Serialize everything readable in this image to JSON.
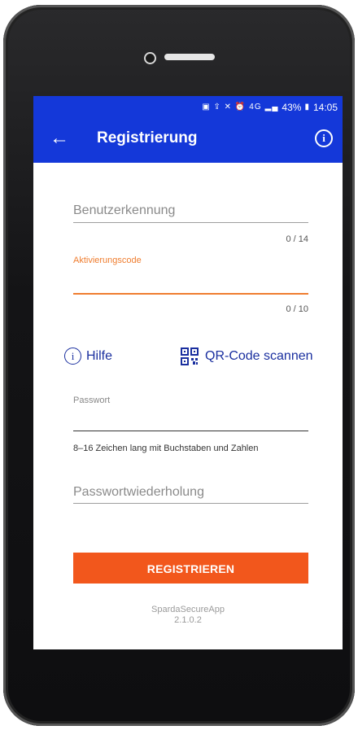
{
  "statusbar": {
    "battery_percent": "43%",
    "time": "14:05",
    "network": "4G",
    "icons": [
      "sim-icon",
      "upload-icon",
      "mute-icon",
      "alarm-icon",
      "signal-icon",
      "battery-icon"
    ]
  },
  "appbar": {
    "title": "Registrierung",
    "back_icon": "arrow-left-icon",
    "info_icon": "info-icon",
    "color": "#1438d9"
  },
  "form": {
    "username": {
      "placeholder": "Benutzerkennung",
      "counter": "0 / 14"
    },
    "activation": {
      "label": "Aktivierungscode",
      "counter": "0 / 10",
      "accent": "#ef7d2f"
    },
    "help_label": "Hilfe",
    "qr_label": "QR-Code scannen",
    "password": {
      "label": "Passwort",
      "hint": "8–16 Zeichen lang mit Buchstaben und Zahlen"
    },
    "password_repeat": {
      "placeholder": "Passwortwiederholung"
    },
    "submit_label": "REGISTRIEREN",
    "submit_color": "#f2571c"
  },
  "footer": {
    "app_name": "SpardaSecureApp",
    "version": "2.1.0.2"
  }
}
